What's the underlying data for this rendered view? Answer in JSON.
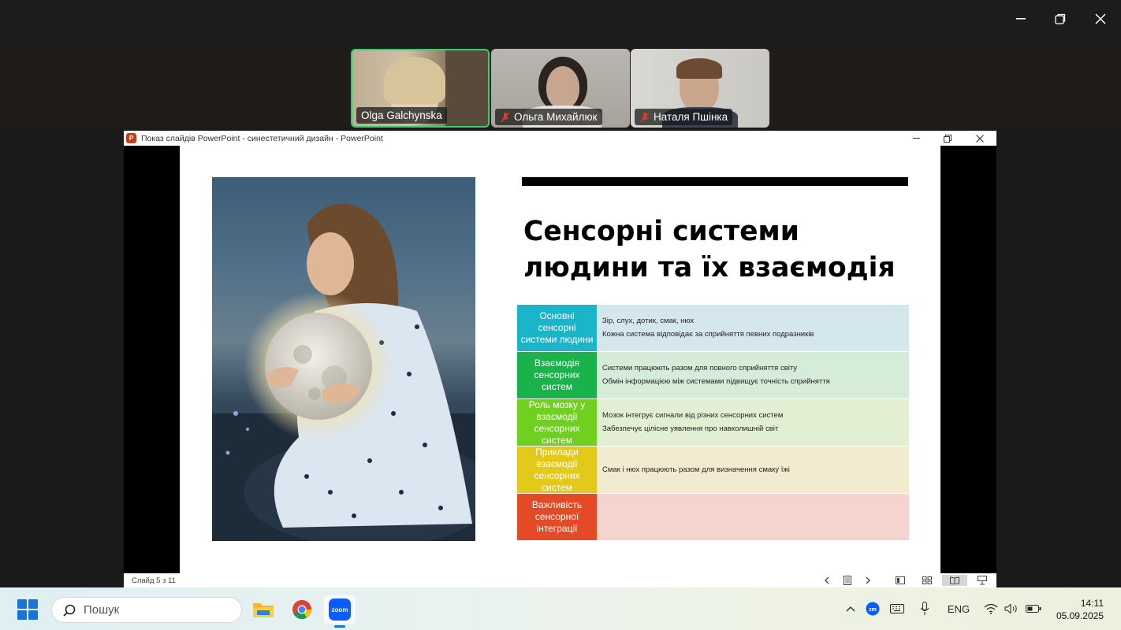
{
  "participants": [
    {
      "name": "Olga Galchynska",
      "muted": false,
      "speaking": true
    },
    {
      "name": "Ольга Михайлюк",
      "muted": true,
      "speaking": false
    },
    {
      "name": "Наталя Пшінка",
      "muted": true,
      "speaking": false
    }
  ],
  "ppt": {
    "window_title": "Показ слайдів PowerPoint  -  синестетичний дизайн - PowerPoint",
    "status": "Слайд 5 з 11"
  },
  "slide": {
    "heading_line1": "Сенсорні системи",
    "heading_line2": "людини та їх взаємодія",
    "rows": [
      {
        "label": "Основні сенсорні системи людини",
        "color": "#1bb5c9",
        "bg": "#d3e7ec",
        "lines": [
          "Зір, слух, дотик, смак, нюх",
          "Кожна система відповідає за сприйняття певних подразників"
        ]
      },
      {
        "label": "Взаємодія сенсорних систем",
        "color": "#19b24b",
        "bg": "#d4ecd8",
        "lines": [
          "Системи працюють разом для повного сприйняття світу",
          "Обмін інформацією між системами підвищує точність сприйняття"
        ]
      },
      {
        "label": "Роль мозку у взаємодії сенсорних систем",
        "color": "#6fd01f",
        "bg": "#e3efd2",
        "lines": [
          "Мозок інтегрує сигнали від різних сенсорних систем",
          "Забезпечує цілісне уявлення про навколишній світ"
        ]
      },
      {
        "label": "Приклади взаємодії сенсорних систем",
        "color": "#e3c91c",
        "bg": "#f2ebcf",
        "lines": [
          "Смак і нюх працюють разом для визначення смаку їжі"
        ]
      },
      {
        "label": "Важливість сенсорної інтеграції",
        "color": "#e44a25",
        "bg": "#f5d4d0",
        "lines": []
      }
    ]
  },
  "taskbar": {
    "search_placeholder": "Пошук",
    "language": "ENG",
    "time": "14:11",
    "date": "05.09.2025"
  }
}
